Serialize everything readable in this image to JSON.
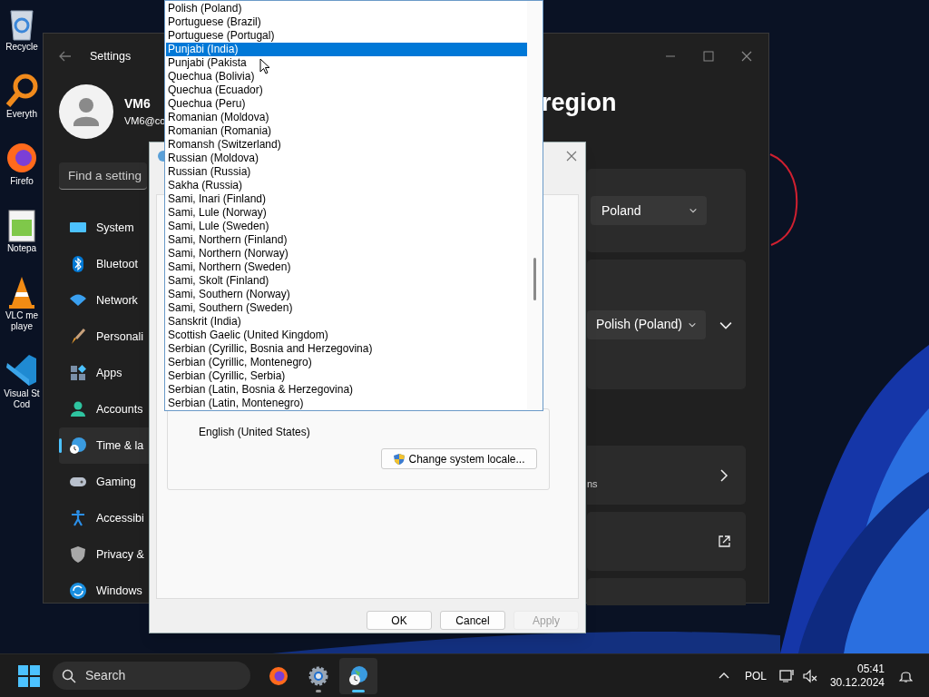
{
  "desktop_icons": [
    {
      "kind": "bin",
      "lines": [
        "Recycle"
      ]
    },
    {
      "kind": "search",
      "lines": [
        "Everyth"
      ]
    },
    {
      "kind": "firefox",
      "lines": [
        "Firefo"
      ]
    },
    {
      "kind": "notepad",
      "lines": [
        "Notepa"
      ]
    },
    {
      "kind": "vlc",
      "lines": [
        "VLC me",
        "playe"
      ]
    },
    {
      "kind": "vscode",
      "lines": [
        "Visual St",
        "Cod"
      ]
    }
  ],
  "settings": {
    "title": "Settings",
    "user": {
      "name": "VM6",
      "email": "VM6@co"
    },
    "search": {
      "placeholder": "Find a setting"
    },
    "nav": [
      {
        "kind": "system",
        "label": "System",
        "selected": false
      },
      {
        "kind": "bluetooth",
        "label": "Bluetoot",
        "selected": false
      },
      {
        "kind": "network",
        "label": "Network",
        "selected": false
      },
      {
        "kind": "brush",
        "label": "Personali",
        "selected": false
      },
      {
        "kind": "apps",
        "label": "Apps",
        "selected": false
      },
      {
        "kind": "accounts",
        "label": "Accounts",
        "selected": false
      },
      {
        "kind": "time",
        "label": "Time & la",
        "selected": true
      },
      {
        "kind": "gaming",
        "label": "Gaming",
        "selected": false
      },
      {
        "kind": "accessibility",
        "label": "Accessibi",
        "selected": false
      },
      {
        "kind": "privacy",
        "label": "Privacy &",
        "selected": false
      },
      {
        "kind": "update",
        "label": "Windows",
        "selected": false
      }
    ],
    "heading": "region",
    "cards": [
      {
        "kind": "select",
        "value": "Poland"
      },
      {
        "kind": "select",
        "value": "Polish (Poland)",
        "expander": true
      },
      {
        "kind": "nav",
        "text": "ns"
      },
      {
        "kind": "external"
      },
      {
        "kind": "empty"
      }
    ]
  },
  "dialog": {
    "locale": "English (United States)",
    "locale_button": "Change system locale...",
    "buttons": [
      {
        "label": "OK",
        "disabled": false
      },
      {
        "label": "Cancel",
        "disabled": false
      },
      {
        "label": "Apply",
        "disabled": true
      }
    ]
  },
  "dropdown": {
    "items": [
      {
        "label": "Polish (Poland)",
        "selected": false
      },
      {
        "label": "Portuguese (Brazil)",
        "selected": false
      },
      {
        "label": "Portuguese (Portugal)",
        "selected": false
      },
      {
        "label": "Punjabi (India)",
        "selected": true
      },
      {
        "label": "Punjabi (Pakista",
        "selected": false
      },
      {
        "label": "Quechua (Bolivia)",
        "selected": false
      },
      {
        "label": "Quechua (Ecuador)",
        "selected": false
      },
      {
        "label": "Quechua (Peru)",
        "selected": false
      },
      {
        "label": "Romanian (Moldova)",
        "selected": false
      },
      {
        "label": "Romanian (Romania)",
        "selected": false
      },
      {
        "label": "Romansh (Switzerland)",
        "selected": false
      },
      {
        "label": "Russian (Moldova)",
        "selected": false
      },
      {
        "label": "Russian (Russia)",
        "selected": false
      },
      {
        "label": "Sakha (Russia)",
        "selected": false
      },
      {
        "label": "Sami, Inari (Finland)",
        "selected": false
      },
      {
        "label": "Sami, Lule (Norway)",
        "selected": false
      },
      {
        "label": "Sami, Lule (Sweden)",
        "selected": false
      },
      {
        "label": "Sami, Northern (Finland)",
        "selected": false
      },
      {
        "label": "Sami, Northern (Norway)",
        "selected": false
      },
      {
        "label": "Sami, Northern (Sweden)",
        "selected": false
      },
      {
        "label": "Sami, Skolt (Finland)",
        "selected": false
      },
      {
        "label": "Sami, Southern (Norway)",
        "selected": false
      },
      {
        "label": "Sami, Southern (Sweden)",
        "selected": false
      },
      {
        "label": "Sanskrit (India)",
        "selected": false
      },
      {
        "label": "Scottish Gaelic (United Kingdom)",
        "selected": false
      },
      {
        "label": "Serbian (Cyrillic, Bosnia and Herzegovina)",
        "selected": false
      },
      {
        "label": "Serbian (Cyrillic, Montenegro)",
        "selected": false
      },
      {
        "label": "Serbian (Cyrillic, Serbia)",
        "selected": false
      },
      {
        "label": "Serbian (Latin, Bosnia & Herzegovina)",
        "selected": false
      },
      {
        "label": "Serbian (Latin, Montenegro)",
        "selected": false
      }
    ]
  },
  "taskbar": {
    "search": {
      "placeholder": "Search"
    },
    "apps": [
      {
        "kind": "firefox",
        "running": false,
        "selected": false
      },
      {
        "kind": "gear",
        "running": true,
        "selected": false
      },
      {
        "kind": "globe",
        "running": true,
        "selected": true
      }
    ],
    "language": "POL",
    "time": "05:41",
    "date": "30.12.2024"
  }
}
